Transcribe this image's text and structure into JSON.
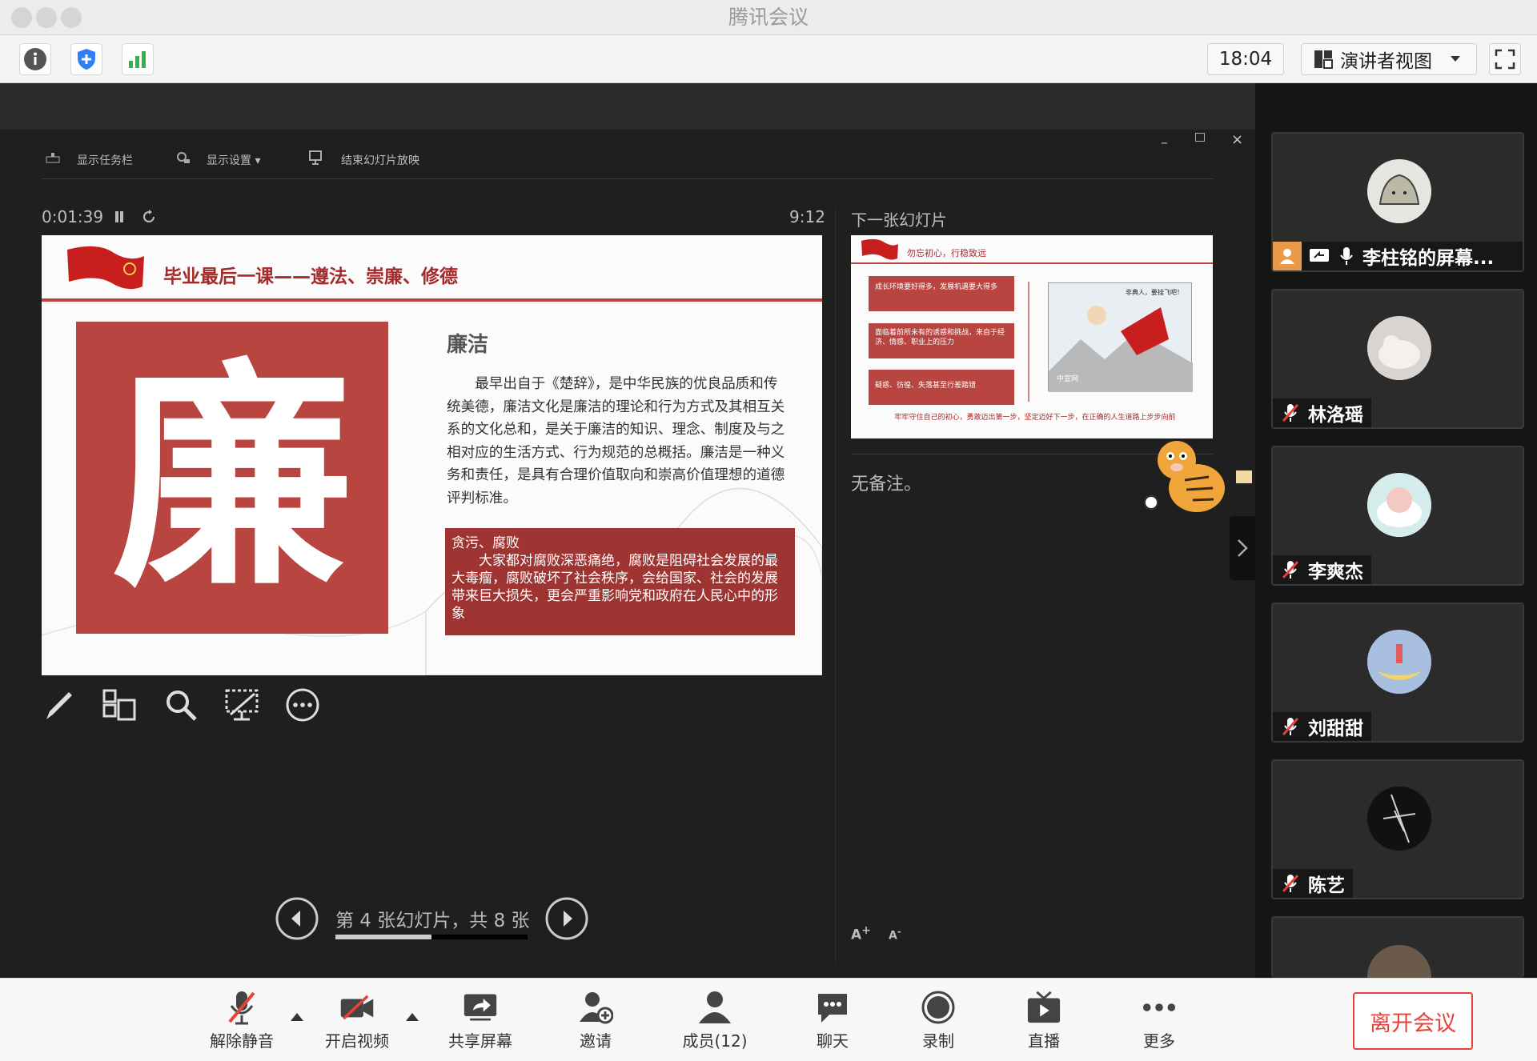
{
  "window": {
    "title": "腾讯会议"
  },
  "toolbar": {
    "time": "18:04",
    "view_mode": "演讲者视图"
  },
  "ppt_controls": {
    "show_taskbar": "显示任务栏",
    "display_settings": "显示设置 ▾",
    "end_slideshow": "结束幻灯片放映"
  },
  "presenter": {
    "elapsed": "0:01:39",
    "clock": "9:12",
    "next_slide_label": "下一张幻灯片",
    "notes": "无备注。",
    "slide_counter": "第 4 张幻灯片，共 8 张",
    "progress": 0.5
  },
  "slide": {
    "title": "毕业最后一课——遵法、崇廉、修德",
    "big_char": "廉",
    "heading": "廉洁",
    "body": "　　最早出自于《楚辞》，是中华民族的优良品质和传统美德，廉洁文化是廉洁的理论和行为方式及其相互关系的文化总和，是关于廉洁的知识、理念、制度及与之相对应的生活方式、行为规范的总概括。廉洁是一种义务和责任，是具有合理价值取向和崇高价值理想的道德评判标准。",
    "box_title": "贪污、腐败",
    "box_body": "　　大家都对腐败深恶痛绝，腐败是阻碍社会发展的最大毒瘤，腐败破坏了社会秩序，会给国家、社会的发展带来巨大损失，更会严重影响党和政府在人民心中的形象"
  },
  "next_slide": {
    "title": "勿忘初心，行稳致远",
    "items": [
      "成长环境要好得多，发展机遇要大得多",
      "面临着前所未有的诱惑和挑战，来自于经济、情感、职业上的压力",
      "疑惑、彷徨、失落甚至行差踏错"
    ],
    "comic_text": "非典人，要挂飞吧！",
    "comic_brand": "中宣网",
    "footer": "牢牢守住自己的初心，勇敢迈出第一步，坚定迈好下一步，在正确的人生道路上步步向前"
  },
  "participants": [
    {
      "name": "李柱铭的屏幕...",
      "sharing": true
    },
    {
      "name": "林洛瑶"
    },
    {
      "name": "李爽杰"
    },
    {
      "name": "刘甜甜"
    },
    {
      "name": "陈艺"
    }
  ],
  "bottom": {
    "unmute": "解除静音",
    "start_video": "开启视频",
    "share": "共享屏幕",
    "invite": "邀请",
    "members": "成员(12)",
    "chat": "聊天",
    "record": "录制",
    "live": "直播",
    "more": "更多",
    "leave": "离开会议"
  },
  "colors": {
    "accent_red": "#e8403b",
    "slide_red": "#b84540",
    "dark_bg": "#1f1f1f"
  }
}
